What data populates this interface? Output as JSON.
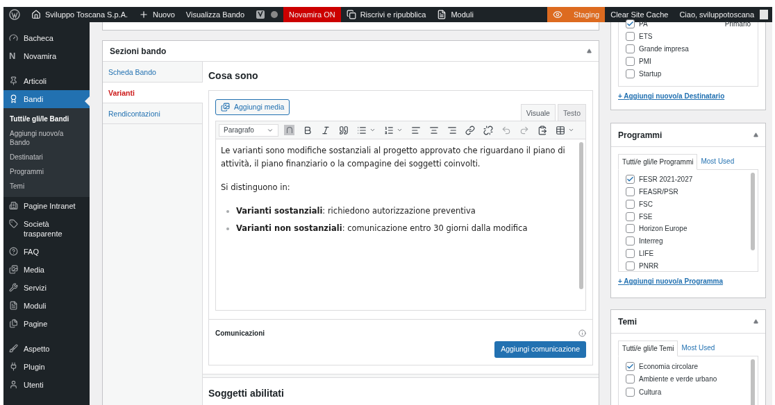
{
  "admin_bar": {
    "left": [
      {
        "kind": "logo"
      },
      {
        "kind": "home",
        "label": "Sviluppo Toscana S.p.A."
      },
      {
        "kind": "plus",
        "label": "Nuovo"
      },
      {
        "kind": "plain",
        "label": "Visualizza Bando"
      },
      {
        "kind": "yoast"
      },
      {
        "kind": "alert",
        "label": "Novamira ON"
      },
      {
        "kind": "copy",
        "label": "Riscrivi e ripubblica"
      },
      {
        "kind": "forms",
        "label": "Moduli"
      }
    ],
    "right": [
      {
        "kind": "staging",
        "label": "Staging"
      },
      {
        "kind": "plain",
        "label": "Clear Site Cache"
      },
      {
        "kind": "user",
        "label": "Ciao, sviluppotoscana"
      }
    ]
  },
  "sidebar": {
    "items": [
      {
        "label": "Bacheca",
        "selected": false
      },
      {
        "icon_letter": "N",
        "label": "Novamira",
        "selected": false
      },
      {
        "label": "Articoli",
        "selected": false
      },
      {
        "label": "Bandi",
        "selected": true,
        "children": [
          {
            "label": "Tutti/e gli/le Bandi",
            "selected": true
          },
          {
            "label": "Aggiungi nuovo/a Bando",
            "selected": false
          },
          {
            "label": "Destinatari",
            "selected": false
          },
          {
            "label": "Programmi",
            "selected": false
          },
          {
            "label": "Temi",
            "selected": false
          }
        ]
      },
      {
        "label": "Pagine Intranet",
        "selected": false
      },
      {
        "label": "Società trasparente",
        "selected": false
      },
      {
        "label": "FAQ",
        "selected": false
      },
      {
        "label": "Media",
        "selected": false
      },
      {
        "label": "Servizi",
        "selected": false
      },
      {
        "label": "Moduli",
        "selected": false
      },
      {
        "label": "Pagine",
        "selected": false
      },
      {
        "label": "Aspetto",
        "selected": false
      },
      {
        "label": "Plugin",
        "selected": false
      },
      {
        "label": "Utenti",
        "selected": false
      }
    ]
  },
  "sections_panel": {
    "title": "Sezioni bando",
    "tabs": [
      {
        "label": "Scheda Bando",
        "selected": false
      },
      {
        "label": "Varianti",
        "selected": true
      },
      {
        "label": "Rendicontazioni",
        "selected": false
      }
    ],
    "heading": "Cosa sono",
    "editor": {
      "media_button": "Aggiungi media",
      "mode_tabs": [
        {
          "label": "Visuale",
          "selected": true
        },
        {
          "label": "Testo",
          "selected": false
        }
      ],
      "format": "Paragrafo",
      "paragraphs": [
        "Le varianti sono modifiche sostanziali al progetto approvato che riguardano il piano di attività, il piano finanziario o la compagine dei soggetti coinvolti.",
        "Si distinguono in:"
      ],
      "bullets": [
        "**Varianti sostanziali**: richiedono autorizzazione preventiva",
        "**Varianti non sostanziali**: comunicazione entro 30 giorni dalla modifica"
      ]
    },
    "communications": {
      "label": "Comunicazioni",
      "button": "Aggiungi comunicazione"
    },
    "next_heading": "Soggetti abilitati"
  },
  "destinatari_box": {
    "items": [
      {
        "label": "PA",
        "checked": true,
        "note": "Primario"
      },
      {
        "label": "ETS",
        "checked": false
      },
      {
        "label": "Grande impresa",
        "checked": false
      },
      {
        "label": "PMI",
        "checked": false
      },
      {
        "label": "Startup",
        "checked": false
      }
    ],
    "add_link": "+ Aggiungi nuovo/a Destinatario"
  },
  "programmi_box": {
    "title": "Programmi",
    "tabs": [
      {
        "label": "Tutti/e gli/le Programmi",
        "selected": true
      },
      {
        "label": "Most Used",
        "selected": false
      }
    ],
    "items": [
      {
        "label": "FESR 2021-2027",
        "checked": true
      },
      {
        "label": "FEASR/PSR",
        "checked": false
      },
      {
        "label": "FSC",
        "checked": false
      },
      {
        "label": "FSE",
        "checked": false
      },
      {
        "label": "Horizon Europe",
        "checked": false
      },
      {
        "label": "Interreg",
        "checked": false
      },
      {
        "label": "LIFE",
        "checked": false
      },
      {
        "label": "PNRR",
        "checked": false
      }
    ],
    "add_link": "+ Aggiungi nuovo/a Programma"
  },
  "temi_box": {
    "title": "Temi",
    "tabs": [
      {
        "label": "Tutti/e gli/le Temi",
        "selected": true
      },
      {
        "label": "Most Used",
        "selected": false
      }
    ],
    "items": [
      {
        "label": "Economia circolare",
        "checked": true
      },
      {
        "label": "Ambiente e verde urbano",
        "checked": false
      },
      {
        "label": "Cultura",
        "checked": false
      }
    ]
  }
}
